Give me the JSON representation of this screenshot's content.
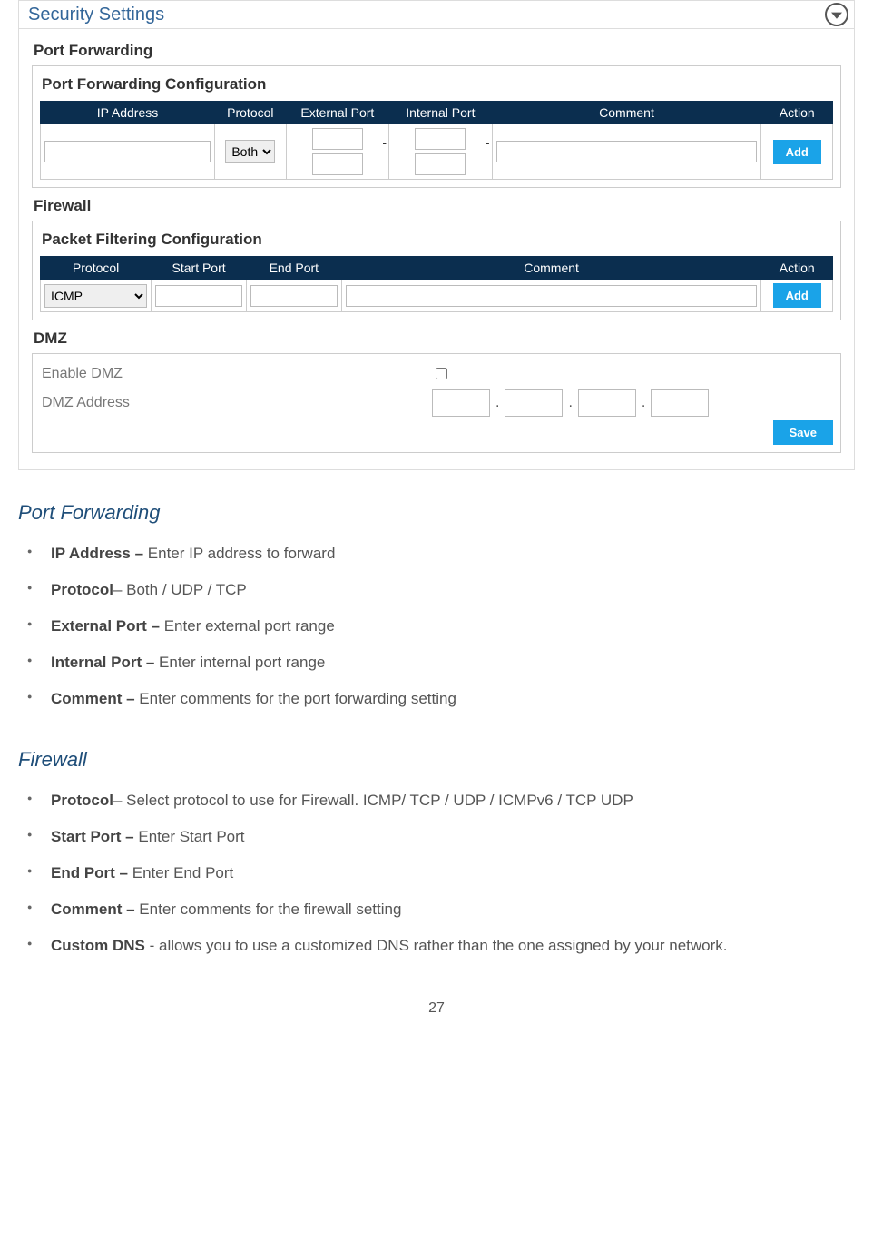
{
  "shot": {
    "title": "Security Settings",
    "portFwd": {
      "section": "Port Forwarding",
      "panel": "Port Forwarding Configuration",
      "cols": {
        "ip": "IP Address",
        "proto": "Protocol",
        "ext": "External Port",
        "int": "Internal Port",
        "comment": "Comment",
        "action": "Action"
      },
      "protoSel": "Both",
      "addBtn": "Add"
    },
    "firewall": {
      "section": "Firewall",
      "panel": "Packet Filtering Configuration",
      "cols": {
        "proto": "Protocol",
        "start": "Start Port",
        "end": "End Port",
        "comment": "Comment",
        "action": "Action"
      },
      "protoSel": "ICMP",
      "addBtn": "Add"
    },
    "dmz": {
      "section": "DMZ",
      "enable": "Enable DMZ",
      "addr": "DMZ Address",
      "saveBtn": "Save"
    }
  },
  "doc": {
    "pf": {
      "heading": "Port Forwarding",
      "items": [
        {
          "b": "IP Address –",
          "t": " Enter IP address to forward"
        },
        {
          "b": "Protocol",
          "t": "– Both / UDP / TCP"
        },
        {
          "b": "External Port –",
          "t": " Enter external port range"
        },
        {
          "b": "Internal Port –",
          "t": " Enter internal port range"
        },
        {
          "b": "Comment –",
          "t": " Enter comments for the port forwarding setting"
        }
      ]
    },
    "fw": {
      "heading": "Firewall",
      "items": [
        {
          "b": "Protocol",
          "t": "– Select protocol to use for Firewall. ICMP/ TCP / UDP / ICMPv6 / TCP UDP"
        },
        {
          "b": "Start Port –",
          "t": " Enter Start Port"
        },
        {
          "b": "End Port –",
          "t": " Enter End Port"
        },
        {
          "b": "Comment –",
          "t": " Enter comments for the firewall setting"
        },
        {
          "b": "Custom DNS ",
          "t": "- allows you to use a customized DNS rather than the one assigned by your network."
        }
      ]
    }
  },
  "pageNumber": "27"
}
